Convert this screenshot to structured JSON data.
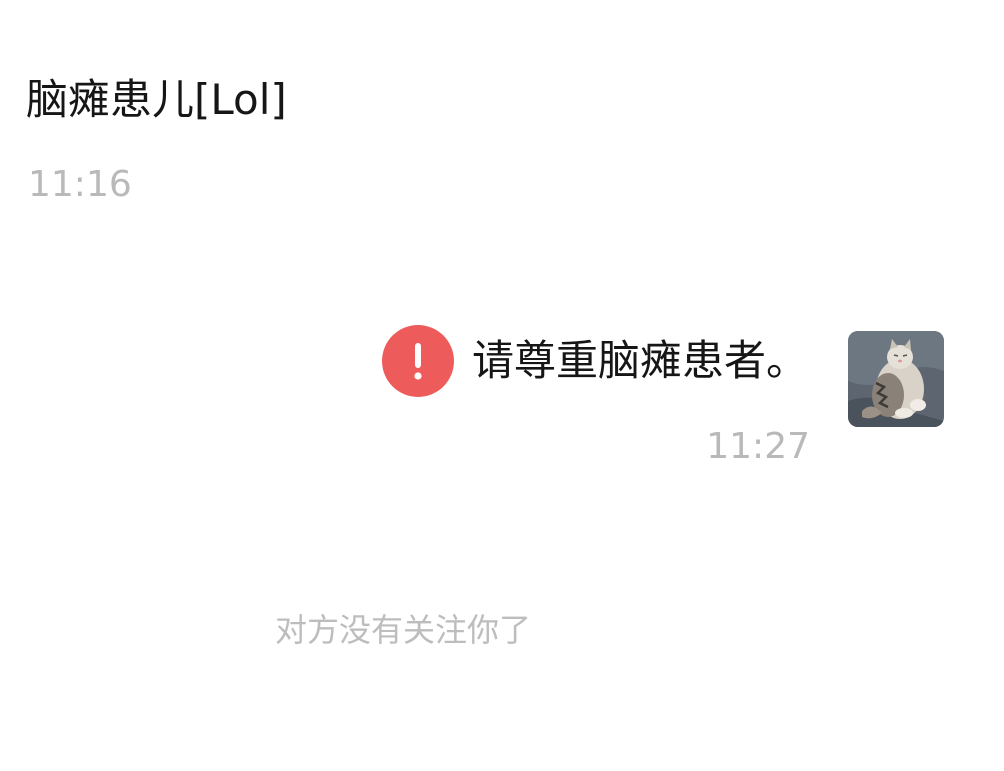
{
  "messages": {
    "incoming": {
      "text": "脑瘫患儿[Lol]",
      "time": "11:16"
    },
    "outgoing": {
      "text": "请尊重脑瘫患者。",
      "time": "11:27",
      "status_icon": "error-exclamation-icon",
      "avatar_icon": "cat-photo-avatar"
    }
  },
  "system_notice": "对方没有关注你了",
  "colors": {
    "error": "#ee5b5b",
    "time_text": "#b9b9b9",
    "body_text": "#161616",
    "notice_text": "#bdbdbd"
  }
}
